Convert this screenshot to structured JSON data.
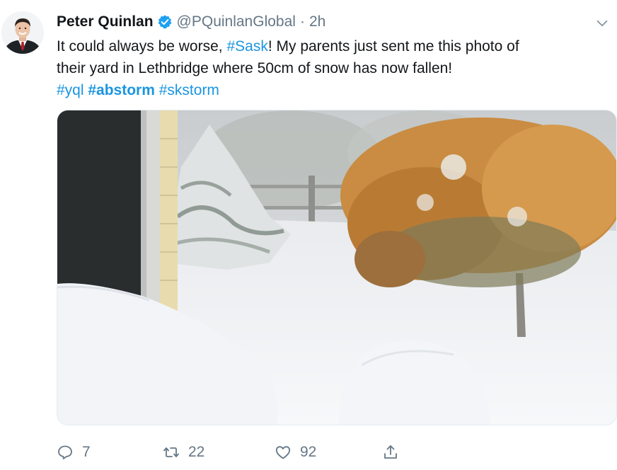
{
  "author": {
    "display_name": "Peter Quinlan",
    "handle": "@PQuinlanGlobal",
    "separator": "·",
    "time": "2h",
    "verified": true
  },
  "tweet": {
    "text_line1_prefix": "It could always be worse, ",
    "hashtag_sask": "#Sask",
    "text_line1_suffix": "! My parents just sent me this photo of",
    "text_line2": "their yard in Lethbridge where 50cm of snow has now fallen!",
    "hashtags": [
      "#yql",
      "#abstorm",
      "#skstorm"
    ]
  },
  "actions": {
    "replies": "7",
    "retweets": "22",
    "likes": "92"
  },
  "icons": {
    "verified": "verified-badge-icon",
    "caret": "chevron-down-icon",
    "reply": "reply-icon",
    "retweet": "retweet-icon",
    "like": "heart-icon",
    "share": "share-icon"
  },
  "colors": {
    "link": "#1b95e0",
    "secondary_text": "#657786",
    "primary_text": "#14171a"
  }
}
